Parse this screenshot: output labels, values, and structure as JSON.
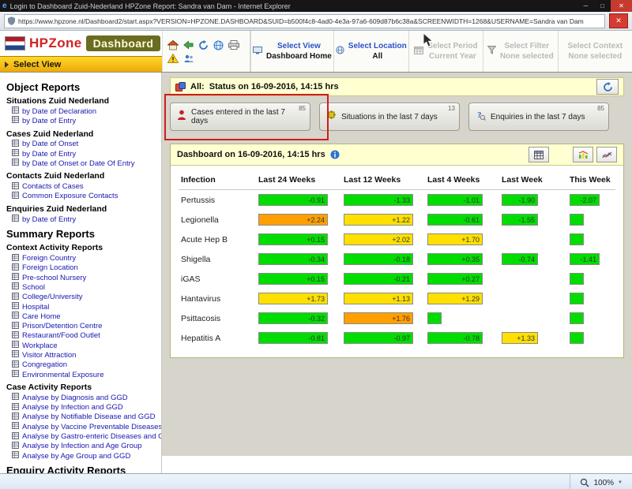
{
  "window": {
    "title": "Login to Dashboard Zuid-Nederland HPZone Report: Sandra van Dam - Internet Explorer",
    "url": "https://www.hpzone.nl/Dashboard2/start.aspx?VERSION=HPZONE.DASHBOARD&SUID=b500f4c8-4ad0-4e3a-97a6-609d87b6c38a&SCREENWIDTH=1268&USERNAME=Sandra van Dam",
    "zoom": "100%"
  },
  "brand": {
    "name_hp": "HPZone",
    "name_dash": "Dashboard",
    "select_view_bar": "Select View"
  },
  "toolbar_icons": [
    "home-icon",
    "back-icon",
    "refresh-icon",
    "globe-icon",
    "printer-icon",
    "warning-icon",
    "people-icon"
  ],
  "nav": {
    "sections": [
      {
        "label": "Select View",
        "value": "Dashboard Home",
        "enabled": true,
        "icon": "monitor"
      },
      {
        "label": "Select Location",
        "value": "All",
        "enabled": true,
        "icon": "globe"
      },
      {
        "label": "Select Period",
        "value": "Current Year",
        "enabled": false,
        "icon": "calendar"
      },
      {
        "label": "Select Filter",
        "value": "None selected",
        "enabled": false,
        "icon": "funnel"
      },
      {
        "label": "Select Context",
        "value": "None selected",
        "enabled": false,
        "icon": null
      }
    ]
  },
  "sidebar": {
    "groups": [
      {
        "heading": "Object Reports",
        "sections": [
          {
            "title": "Situations Zuid Nederland",
            "links": [
              "by Date of Declaration",
              "by Date of Entry"
            ]
          },
          {
            "title": "Cases Zuid Nederland",
            "links": [
              "by Date of Onset",
              "by Date of Entry",
              "by Date of Onset or Date Of Entry"
            ]
          },
          {
            "title": "Contacts Zuid Nederland",
            "links": [
              "Contacts of Cases",
              "Common Exposure Contacts"
            ]
          },
          {
            "title": "Enquiries Zuid Nederland",
            "links": [
              "by Date of Entry"
            ]
          }
        ]
      },
      {
        "heading": "Summary Reports",
        "sections": [
          {
            "title": "Context Activity Reports",
            "links": [
              "Foreign Country",
              "Foreign Location",
              "Pre-school Nursery",
              "School",
              "College/University",
              "Hospital",
              "Care Home",
              "Prison/Detention Centre",
              "Restaurant/Food Outlet",
              "Workplace",
              "Visitor Attraction",
              "Congregation",
              "Environmental Exposure"
            ]
          },
          {
            "title": "Case Activity Reports",
            "links": [
              "Analyse by Diagnosis and GGD",
              "Analyse by Infection and GGD",
              "Analyse by Notifiable Disease and GGD",
              "Analyse by Vaccine Preventable Diseases and G",
              "Analyse by Gastro-enteric Diseases and GGD",
              "Analyse by Infection and Age Group",
              "Analyse by Age Group and GGD"
            ]
          }
        ]
      },
      {
        "heading": "Enquiry Activity Reports",
        "sections": []
      }
    ]
  },
  "status_bar": {
    "prefix": "All:",
    "text": "Status on 16-09-2016, 14:15 hrs"
  },
  "cards": [
    {
      "label": "Cases entered in the last 7 days",
      "count": "85",
      "icon": "cases",
      "highlighted": true
    },
    {
      "label": "Situations in the last 7 days",
      "count": "13",
      "icon": "situations",
      "highlighted": false
    },
    {
      "label": "Enquiries in the last 7 days",
      "count": "85",
      "icon": "enquiries",
      "highlighted": false
    }
  ],
  "dashboard": {
    "title": "Dashboard on 16-09-2016, 14:15 hrs",
    "buttons": [
      "table-view-button",
      "combo-chart-button",
      "line-chart-button"
    ],
    "table": {
      "columns": [
        "Infection",
        "Last 24 Weeks",
        "Last 12 Weeks",
        "Last 4 Weeks",
        "Last Week",
        "This Week"
      ],
      "colors": {
        "green": "#00dd00",
        "yellow": "#ffe000",
        "orange": "#ffa000"
      },
      "rows": [
        {
          "infection": "Pertussis",
          "cells": [
            {
              "v": "-0.91",
              "c": "green"
            },
            {
              "v": "-1.33",
              "c": "green"
            },
            {
              "v": "-1.01",
              "c": "green"
            },
            {
              "v": "-1.90",
              "c": "green"
            },
            {
              "v": "-2.07",
              "c": "green"
            }
          ]
        },
        {
          "infection": "Legionella",
          "cells": [
            {
              "v": "+2.24",
              "c": "orange"
            },
            {
              "v": "+1.22",
              "c": "yellow"
            },
            {
              "v": "-0.61",
              "c": "green"
            },
            {
              "v": "-1.55",
              "c": "green"
            },
            {
              "v": "",
              "c": "green"
            }
          ]
        },
        {
          "infection": "Acute Hep B",
          "cells": [
            {
              "v": "+0.15",
              "c": "green"
            },
            {
              "v": "+2.02",
              "c": "yellow"
            },
            {
              "v": "+1.70",
              "c": "yellow"
            },
            null,
            {
              "v": "",
              "c": "green"
            }
          ]
        },
        {
          "infection": "Shigella",
          "cells": [
            {
              "v": "-0.34",
              "c": "green"
            },
            {
              "v": "-0.18",
              "c": "green"
            },
            {
              "v": "+0.35",
              "c": "green"
            },
            {
              "v": "-0.74",
              "c": "green"
            },
            {
              "v": "-1.41",
              "c": "green"
            }
          ]
        },
        {
          "infection": "iGAS",
          "cells": [
            {
              "v": "+0.15",
              "c": "green"
            },
            {
              "v": "-0.21",
              "c": "green"
            },
            {
              "v": "+0.27",
              "c": "green"
            },
            null,
            {
              "v": "",
              "c": "green"
            }
          ]
        },
        {
          "infection": "Hantavirus",
          "cells": [
            {
              "v": "+1.73",
              "c": "yellow"
            },
            {
              "v": "+1.13",
              "c": "yellow"
            },
            {
              "v": "+1.29",
              "c": "yellow"
            },
            null,
            {
              "v": "",
              "c": "green"
            }
          ]
        },
        {
          "infection": "Psittacosis",
          "cells": [
            {
              "v": "-0.32",
              "c": "green"
            },
            {
              "v": "+1.76",
              "c": "orange"
            },
            {
              "v": "",
              "c": "green"
            },
            null,
            {
              "v": "",
              "c": "green"
            }
          ]
        },
        {
          "infection": "Hepatitis A",
          "cells": [
            {
              "v": "-0.81",
              "c": "green"
            },
            {
              "v": "-0.97",
              "c": "green"
            },
            {
              "v": "-0.78",
              "c": "green"
            },
            {
              "v": "+1.33",
              "c": "yellow"
            },
            {
              "v": "",
              "c": "green"
            }
          ]
        }
      ]
    }
  }
}
